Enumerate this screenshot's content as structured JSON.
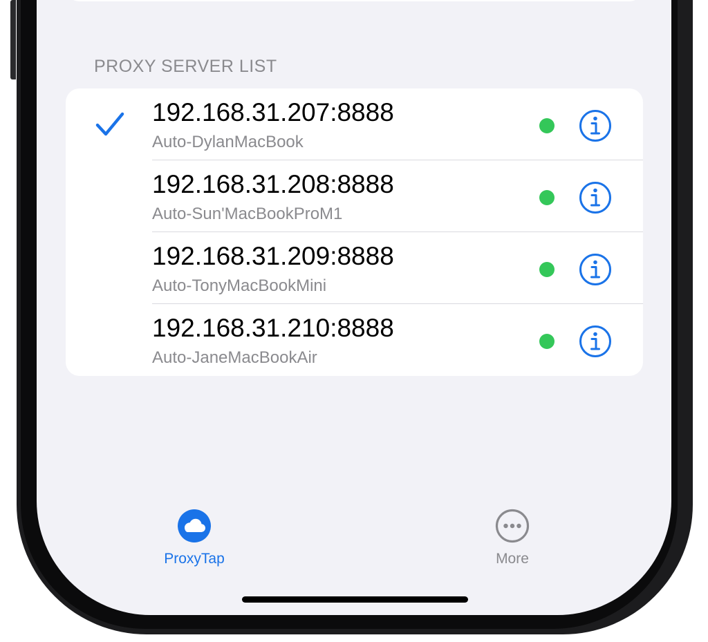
{
  "section": {
    "header": "PROXY SERVER LIST"
  },
  "servers": [
    {
      "address": "192.168.31.207:8888",
      "name": "Auto-DylanMacBook",
      "selected": true,
      "status": "online"
    },
    {
      "address": "192.168.31.208:8888",
      "name": "Auto-Sun'MacBookProM1",
      "selected": false,
      "status": "online"
    },
    {
      "address": "192.168.31.209:8888",
      "name": "Auto-TonyMacBookMini",
      "selected": false,
      "status": "online"
    },
    {
      "address": "192.168.31.210:8888",
      "name": "Auto-JaneMacBookAir",
      "selected": false,
      "status": "online"
    }
  ],
  "tabbar": {
    "tabs": [
      {
        "label": "ProxyTap",
        "icon": "cloud-icon",
        "active": true
      },
      {
        "label": "More",
        "icon": "ellipsis-circle-icon",
        "active": false
      }
    ]
  },
  "colors": {
    "accent": "#1a73e8",
    "status_online": "#34c759",
    "secondary_text": "#8a8a8e",
    "background": "#f2f2f7"
  },
  "icons": {
    "selected": "checkmark-icon",
    "info": "info-circle-icon",
    "status": "status-dot-icon"
  }
}
